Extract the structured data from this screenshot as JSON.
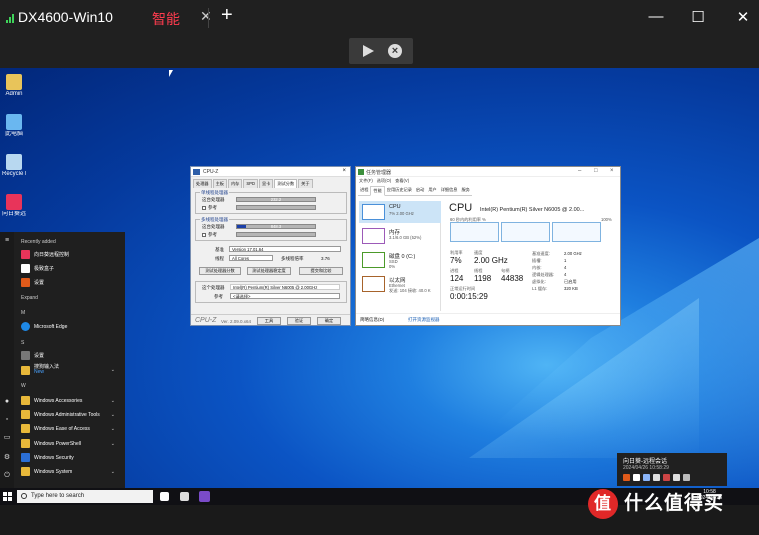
{
  "app": {
    "title": "DX4600-Win10",
    "mode": "智能",
    "tab_close": "✕",
    "tab_add": "+",
    "minimize": "—",
    "maximize": "☐",
    "close": "✕"
  },
  "desktop": {
    "icons": [
      {
        "label": "Admin"
      },
      {
        "label": "此电脑"
      },
      {
        "label": "Recycle Bin"
      },
      {
        "label": "向日葵远程控制"
      }
    ]
  },
  "start_menu": {
    "recently_added": "Recently added",
    "recent": [
      "向日葵远程控制",
      "极致盒子",
      "设置"
    ],
    "expand": "Expand",
    "letter_m": "M",
    "microsoft_edge": "Microsoft Edge",
    "letter_s": "S",
    "settings": "设置",
    "sougou": "搜狗输入法",
    "new_badge": "New",
    "letter_w": "W",
    "folders": [
      "Windows Accessories",
      "Windows Administrative Tools",
      "Windows Ease of Access",
      "Windows PowerShell",
      "Windows Security",
      "Windows System"
    ]
  },
  "taskbar": {
    "search_placeholder": "Type here to search",
    "time": "10:58",
    "date": "2024/04/26"
  },
  "toast": {
    "title": "向日葵-远程会话",
    "time": "2024/04/26 10:58:29"
  },
  "cpuz": {
    "title": "CPU-Z",
    "tabs": [
      "处理器",
      "主板",
      "内存",
      "SPD",
      "显卡",
      "测试分数",
      "关于"
    ],
    "single_group": "单线程处理器",
    "this_cpu": "这台处理器",
    "ref": "参考",
    "single_score": "232.2",
    "multi_group": "多线程处理器",
    "multi_score": "848.3",
    "baseline_label": "基准",
    "baseline_value": "Version 17.01.64",
    "threads_label": "线程",
    "threads_value": "All Cores",
    "multi_ratio_label": "多线程倍率",
    "multi_ratio_value": "3.76",
    "btn_bench": "测试处理器分数",
    "btn_stress": "测试处理器稳定度",
    "btn_submit": "提交和比较",
    "this_cpu_label": "这个处理器",
    "this_cpu_value": "Intel(R) Pentium(R) Silver N6005 @ 2.00GHz",
    "ref_label": "参考",
    "ref_value": "<请选择>",
    "footer_logo": "CPU-Z",
    "version": "Ver. 2.09.0.x64",
    "tools": "工具",
    "validate": "验证",
    "ok": "确定"
  },
  "taskmgr": {
    "title": "任务管理器",
    "menu": [
      "文件(F)",
      "选项(O)",
      "查看(V)"
    ],
    "tabs": [
      "进程",
      "性能",
      "应用历史记录",
      "启动",
      "用户",
      "详细信息",
      "服务"
    ],
    "side": [
      {
        "name": "CPU",
        "sub": "7% 2.00 GHz"
      },
      {
        "name": "内存",
        "sub": "3.1/6.0 GB (52%)"
      },
      {
        "name": "磁盘 0 (C:)",
        "sub": "SSD\n0%"
      },
      {
        "name": "以太网",
        "sub": "Ethernet\n发送: 104 接收: 40.0 K"
      }
    ],
    "big": "CPU",
    "model": "Intel(R) Pentium(R) Silver N6005 @ 2.00...",
    "graph_label": "60 秒内的利用率 %",
    "graph_max": "100%",
    "util_label": "利用率",
    "util": "7%",
    "speed_label": "速度",
    "speed": "2.00 GHz",
    "proc_label": "进程",
    "proc": "124",
    "threads_label": "线程",
    "threads": "1198",
    "handles_label": "句柄",
    "handles": "44838",
    "uptime_label": "正常运行时间",
    "uptime": "0:00:15:29",
    "base_speed_label": "基准速度:",
    "base_speed": "2.00 GHz",
    "sockets_label": "插槽:",
    "sockets": "1",
    "cores_label": "内核:",
    "cores": "4",
    "lp_label": "逻辑处理器:",
    "lp": "4",
    "virt_label": "虚拟化:",
    "virt": "已启用",
    "l1_label": "L1 缓存:",
    "l1": "320 KB",
    "fewer": "简略信息(D)",
    "open_monitor": "打开资源监视器"
  },
  "watermark": {
    "badge": "值",
    "text": "什么值得买"
  }
}
